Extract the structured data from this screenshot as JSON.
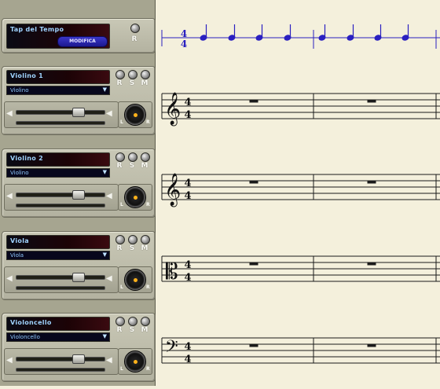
{
  "tempo": {
    "title": "Tap del Tempo",
    "button": "MODIFICA",
    "r_label": "R"
  },
  "tracks": [
    {
      "name": "Violino 1",
      "instrument": "Violino",
      "clef": "treble",
      "pan": "L R"
    },
    {
      "name": "Violino 2",
      "instrument": "Violino",
      "clef": "treble"
    },
    {
      "name": "Viola",
      "instrument": "Viola",
      "clef": "alto"
    },
    {
      "name": "Violoncello",
      "instrument": "Violoncello",
      "clef": "bass"
    }
  ],
  "labels": {
    "rec": "R",
    "solo": "S",
    "mute": "M",
    "left": "L",
    "right": "R"
  },
  "time_signature": {
    "numerator": "4",
    "denominator": "4"
  },
  "colors": {
    "tempo_staff": "#2a20c0",
    "name_text": "#9fd3ff",
    "pan_dot": "#ffb21a",
    "score_bg": "#f4f0dc"
  }
}
